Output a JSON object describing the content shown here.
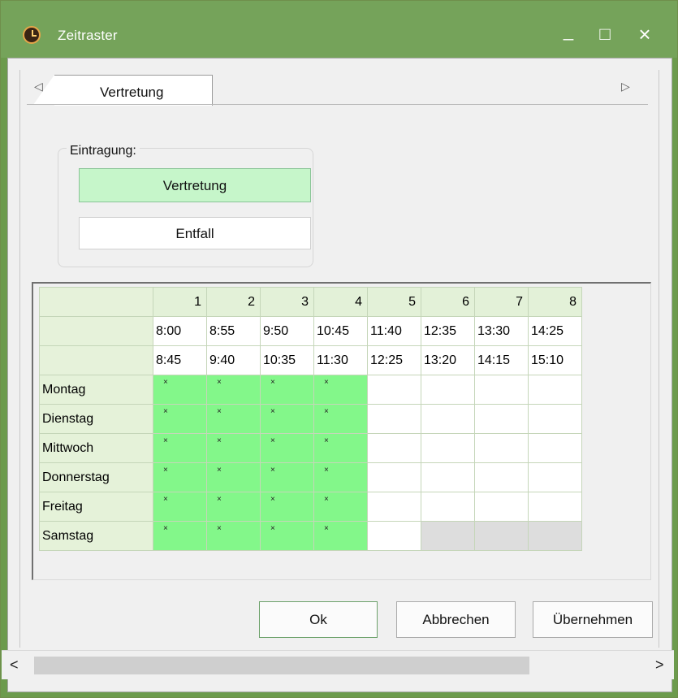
{
  "window": {
    "title": "Zeitraster",
    "minimize_label": "_",
    "maximize_label": "□",
    "close_label": "×",
    "icon": "clock-icon"
  },
  "tabs": {
    "items": [
      {
        "label": "Vertretung",
        "selected": true
      }
    ],
    "left_arrow": "◁",
    "right_arrow": "▷"
  },
  "eintragung": {
    "label": "Eintragung:",
    "buttons": [
      {
        "label": "Vertretung",
        "selected": true,
        "color": "#c6f6ca"
      },
      {
        "label": "Entfall",
        "selected": false,
        "color": "#ffffff"
      }
    ]
  },
  "grid": {
    "periods": [
      "1",
      "2",
      "3",
      "4",
      "5",
      "6",
      "7",
      "8"
    ],
    "starts": [
      "8:00",
      "8:55",
      "9:50",
      "10:45",
      "11:40",
      "12:35",
      "13:30",
      "14:25"
    ],
    "ends": [
      "8:45",
      "9:40",
      "10:35",
      "11:30",
      "12:25",
      "13:20",
      "14:15",
      "15:10"
    ],
    "days": [
      {
        "name": "Montag",
        "cells": [
          "×",
          "×",
          "×",
          "×",
          "",
          "",
          "",
          ""
        ]
      },
      {
        "name": "Dienstag",
        "cells": [
          "×",
          "×",
          "×",
          "×",
          "",
          "",
          "",
          ""
        ]
      },
      {
        "name": "Mittwoch",
        "cells": [
          "×",
          "×",
          "×",
          "×",
          "",
          "",
          "",
          ""
        ]
      },
      {
        "name": "Donnerstag",
        "cells": [
          "×",
          "×",
          "×",
          "×",
          "",
          "",
          "",
          ""
        ]
      },
      {
        "name": "Freitag",
        "cells": [
          "×",
          "×",
          "×",
          "×",
          "",
          "",
          "",
          ""
        ]
      },
      {
        "name": "Samstag",
        "cells": [
          "×",
          "×",
          "×",
          "×",
          "",
          "",
          "",
          ""
        ]
      }
    ]
  },
  "buttons": {
    "ok": "Ok",
    "cancel": "Abbrechen",
    "apply": "Übernehmen"
  },
  "scrollbar": {
    "left": "<",
    "right": ">"
  },
  "colors": {
    "active_cell": "#83f78a",
    "disabled_cell": "#dddddd",
    "title_bar": "#75a35a"
  }
}
